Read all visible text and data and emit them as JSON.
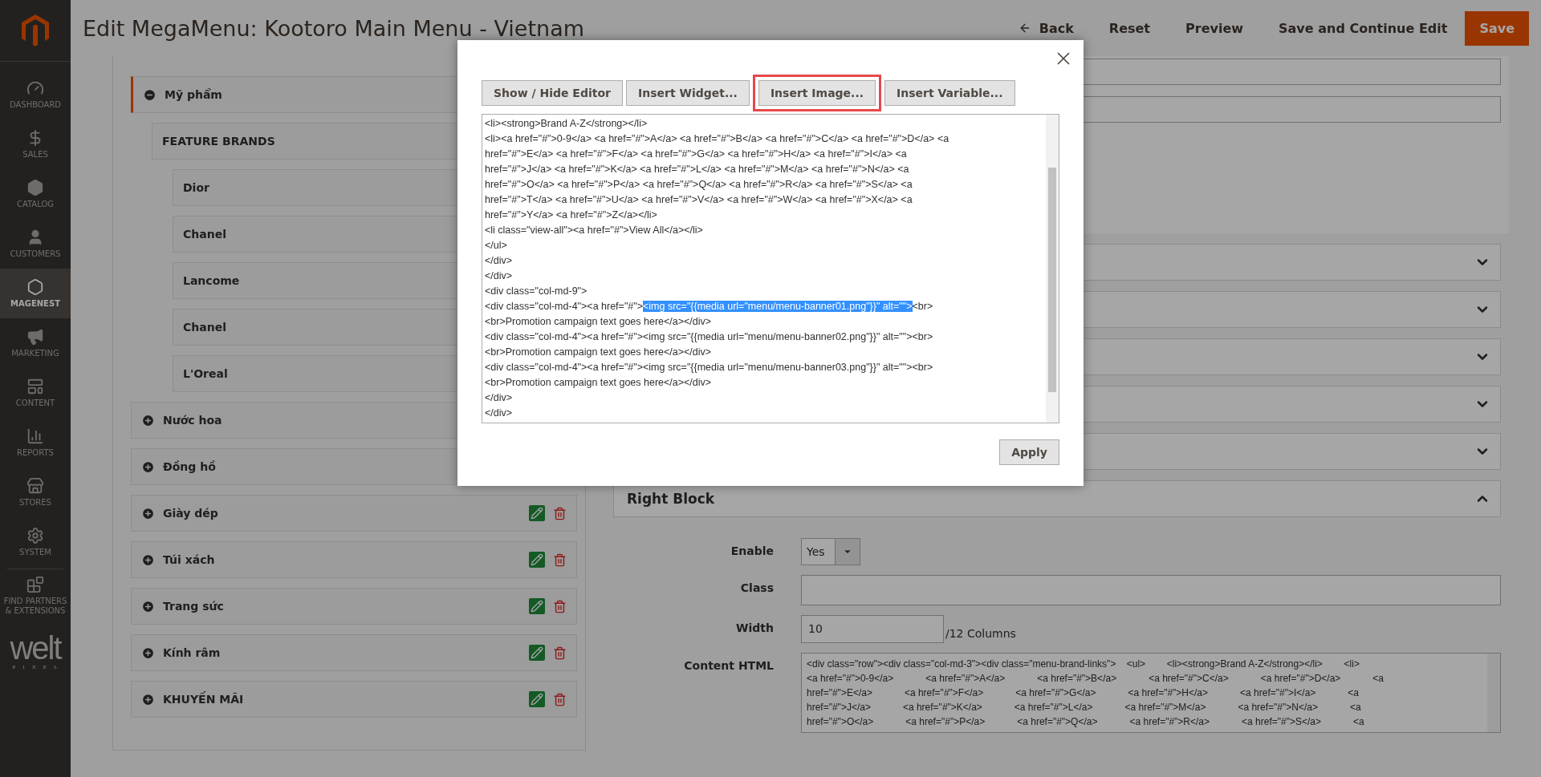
{
  "sidebar": {
    "items": [
      {
        "label": "DASHBOARD",
        "selected": false
      },
      {
        "label": "SALES",
        "selected": false
      },
      {
        "label": "CATALOG",
        "selected": false
      },
      {
        "label": "CUSTOMERS",
        "selected": false
      },
      {
        "label": "MAGENEST",
        "selected": true
      },
      {
        "label": "MARKETING",
        "selected": false
      },
      {
        "label": "CONTENT",
        "selected": false
      },
      {
        "label": "REPORTS",
        "selected": false
      },
      {
        "label": "STORES",
        "selected": false
      },
      {
        "label": "SYSTEM",
        "selected": false
      },
      {
        "label": "FIND PARTNERS & EXTENSIONS",
        "selected": false
      }
    ],
    "brand": {
      "word": "welt",
      "tagline": "PIXEL"
    }
  },
  "header": {
    "title": "Edit MegaMenu: Kootoro Main Menu - Vietnam",
    "actions": [
      {
        "label": "Back",
        "kind": "back"
      },
      {
        "label": "Reset",
        "kind": "plain"
      },
      {
        "label": "Preview",
        "kind": "plain"
      },
      {
        "label": "Save and Continue Edit",
        "kind": "plain"
      },
      {
        "label": "Save",
        "kind": "primary"
      }
    ]
  },
  "menu_tree": [
    {
      "label": "Mỹ phẩm",
      "expanded": true,
      "children": [
        {
          "label": "FEATURE BRANDS",
          "children": [
            {
              "label": "Dior"
            },
            {
              "label": "Chanel"
            },
            {
              "label": "Lancome"
            },
            {
              "label": "Chanel"
            },
            {
              "label": "L'Oreal"
            }
          ]
        }
      ]
    },
    {
      "label": "Nước hoa",
      "expanded": false
    },
    {
      "label": "Đồng hồ",
      "expanded": false
    },
    {
      "label": "Giày dép",
      "expanded": false
    },
    {
      "label": "Túi xách",
      "expanded": false
    },
    {
      "label": "Trang sức",
      "expanded": false
    },
    {
      "label": "Kính râm",
      "expanded": false
    },
    {
      "label": "KHUYẾN MÃI",
      "expanded": false
    }
  ],
  "right_panel": {
    "sections": [
      {
        "expanded": false
      },
      {
        "expanded": false
      },
      {
        "expanded": false
      },
      {
        "expanded": false
      },
      {
        "expanded": false
      },
      {
        "title": "Right Block",
        "expanded": true
      }
    ],
    "form": {
      "enable": {
        "label": "Enable",
        "value": "Yes"
      },
      "class": {
        "label": "Class"
      },
      "width": {
        "label": "Width",
        "value": "10",
        "suffix": "/12 Columns"
      },
      "content_html": {
        "label": "Content HTML",
        "lines": [
          "<div class=\"row\"><div class=\"col-md-3\"><div class=\"menu-brand-links\">    <ul>        <li><strong>Brand A-Z</strong></li>        <li>",
          "<a href=\"#\">0-9</a>            <a href=\"#\">A</a>            <a href=\"#\">B</a>            <a href=\"#\">C</a>            <a href=\"#\">D</a>            <a",
          "href=\"#\">E</a>            <a href=\"#\">F</a>            <a href=\"#\">G</a>            <a href=\"#\">H</a>            <a href=\"#\">I</a>            <a",
          "href=\"#\">J</a>            <a href=\"#\">K</a>            <a href=\"#\">L</a>            <a href=\"#\">M</a>            <a href=\"#\">N</a>            <a",
          "href=\"#\">O</a>            <a href=\"#\">P</a>            <a href=\"#\">Q</a>            <a href=\"#\">R</a>            <a href=\"#\">S</a>            <a"
        ]
      }
    }
  },
  "modal": {
    "toolbar": [
      {
        "label": "Show / Hide Editor",
        "selected": false
      },
      {
        "label": "Insert Widget...",
        "selected": false
      },
      {
        "label": "Insert Image...",
        "selected": true
      },
      {
        "label": "Insert Variable...",
        "selected": false
      }
    ],
    "editor_lines": [
      [
        {
          "text": "<li><strong>Brand A-Z</strong></li>",
          "selected": false
        }
      ],
      [
        {
          "text": "<li><a href=\"#\">0-9</a> <a href=\"#\">A</a> <a href=\"#\">B</a> <a href=\"#\">C</a> <a href=\"#\">D</a> <a",
          "selected": false
        }
      ],
      [
        {
          "text": "href=\"#\">E</a> <a href=\"#\">F</a> <a href=\"#\">G</a> <a href=\"#\">H</a> <a href=\"#\">I</a> <a",
          "selected": false
        }
      ],
      [
        {
          "text": "href=\"#\">J</a> <a href=\"#\">K</a> <a href=\"#\">L</a> <a href=\"#\">M</a> <a href=\"#\">N</a> <a",
          "selected": false
        }
      ],
      [
        {
          "text": "href=\"#\">O</a> <a href=\"#\">P</a> <a href=\"#\">Q</a> <a href=\"#\">R</a> <a href=\"#\">S</a> <a",
          "selected": false
        }
      ],
      [
        {
          "text": "href=\"#\">T</a> <a href=\"#\">U</a> <a href=\"#\">V</a> <a href=\"#\">W</a> <a href=\"#\">X</a> <a",
          "selected": false
        }
      ],
      [
        {
          "text": "href=\"#\">Y</a> <a href=\"#\">Z</a></li>",
          "selected": false
        }
      ],
      [
        {
          "text": "<li class=\"view-all\"><a href=\"#\">View All</a></li>",
          "selected": false
        }
      ],
      [
        {
          "text": "</ul>",
          "selected": false
        }
      ],
      [
        {
          "text": "</div>",
          "selected": false
        }
      ],
      [
        {
          "text": "</div>",
          "selected": false
        }
      ],
      [
        {
          "text": "<div class=\"col-md-9\">",
          "selected": false
        }
      ],
      [
        {
          "text": "<div class=\"col-md-4\"><a href=\"#\">",
          "selected": false
        },
        {
          "text": "<img src=\"{{media url=\"menu/menu-banner01.png\"}}\" alt=\"\">",
          "selected": true
        },
        {
          "text": "<br>",
          "selected": false
        }
      ],
      [
        {
          "text": "<br>Promotion campaign text goes here</a></div>",
          "selected": false
        }
      ],
      [
        {
          "text": "<div class=\"col-md-4\"><a href=\"#\"><img src=\"{{media url=\"menu/menu-banner02.png\"}}\" alt=\"\"><br>",
          "selected": false
        }
      ],
      [
        {
          "text": "<br>Promotion campaign text goes here</a></div>",
          "selected": false
        }
      ],
      [
        {
          "text": "<div class=\"col-md-4\"><a href=\"#\"><img src=\"{{media url=\"menu/menu-banner03.png\"}}\" alt=\"\"><br>",
          "selected": false
        }
      ],
      [
        {
          "text": "<br>Promotion campaign text goes here</a></div>",
          "selected": false
        }
      ],
      [
        {
          "text": "</div>",
          "selected": false
        }
      ],
      [
        {
          "text": "</div>",
          "selected": false
        }
      ]
    ],
    "apply": "Apply"
  }
}
